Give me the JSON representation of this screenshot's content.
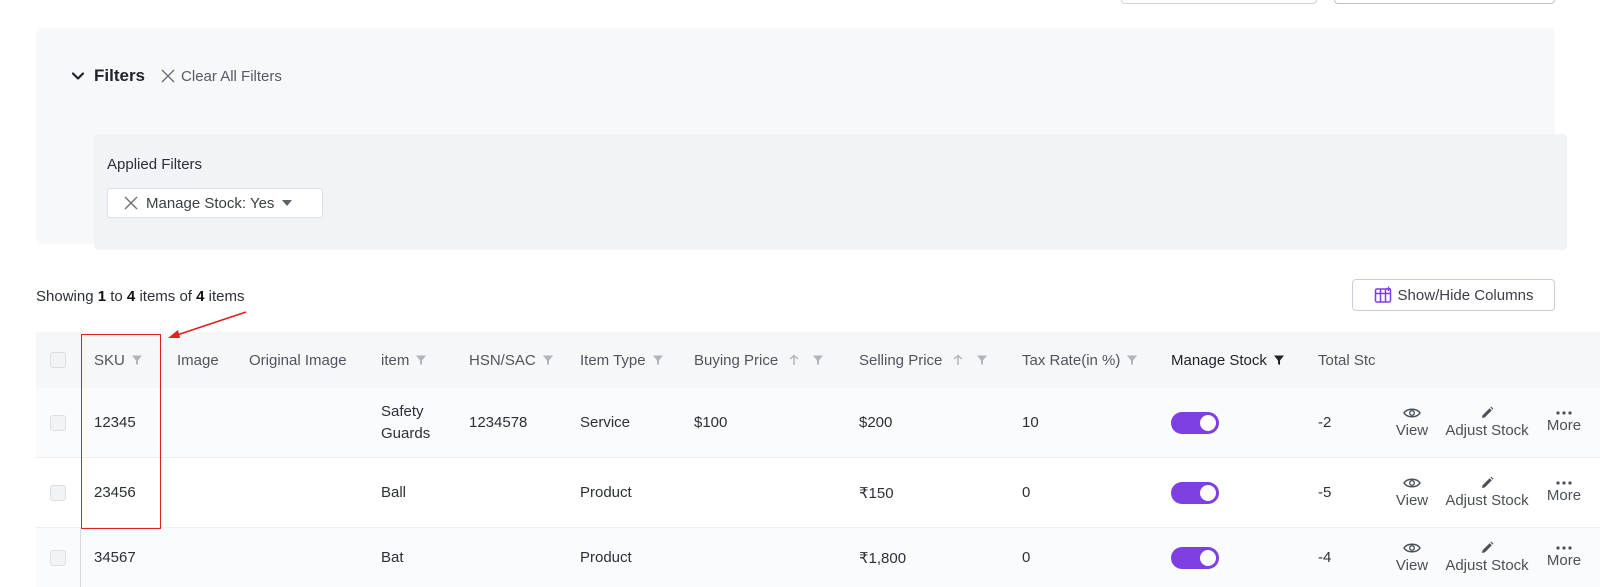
{
  "filters": {
    "title": "Filters",
    "clear_all": "Clear All Filters",
    "applied_label": "Applied Filters",
    "chip_label": "Manage Stock: Yes"
  },
  "summary": {
    "showing": "Showing",
    "from": "1",
    "to_word": "to",
    "to": "4",
    "items_of": "items of",
    "total": "4",
    "items": "items"
  },
  "toolbar": {
    "show_hide_columns": "Show/Hide Columns"
  },
  "table": {
    "headers": {
      "sku": "SKU",
      "image": "Image",
      "original_image": "Original Image",
      "item": "item",
      "hsn": "HSN/SAC",
      "item_type": "Item Type",
      "buying_price": "Buying Price",
      "selling_price": "Selling Price",
      "tax_rate": "Tax Rate(in %)",
      "manage_stock": "Manage Stock",
      "total_stock": "Total Stc"
    },
    "actions": {
      "view": "View",
      "adjust": "Adjust Stock",
      "more": "More"
    },
    "rows": [
      {
        "sku": "12345",
        "item_line1": "Safety",
        "item_line2": "Guards",
        "hsn": "1234578",
        "item_type": "Service",
        "buying_price": "$100",
        "selling_price": "$200",
        "tax_rate": "10",
        "manage_stock": true,
        "total_stock": "-2"
      },
      {
        "sku": "23456",
        "item": "Ball",
        "hsn": "",
        "item_type": "Product",
        "buying_price": "",
        "selling_price": "₹150",
        "tax_rate": "0",
        "manage_stock": true,
        "total_stock": "-5"
      },
      {
        "sku": "34567",
        "item": "Bat",
        "hsn": "",
        "item_type": "Product",
        "buying_price": "",
        "selling_price": "₹1,800",
        "tax_rate": "0",
        "manage_stock": true,
        "total_stock": "-4"
      }
    ]
  },
  "colors": {
    "accent": "#7e3fe0",
    "annotation": "#e02020"
  }
}
